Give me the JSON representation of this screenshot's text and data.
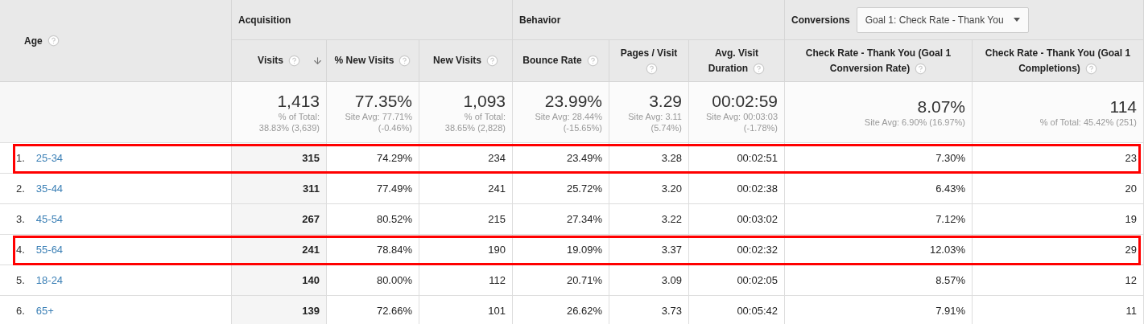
{
  "dimension": {
    "label": "Age"
  },
  "groups": [
    {
      "label": "Acquisition",
      "columns": [
        {
          "label": "Visits",
          "sorted": true
        },
        {
          "label": "% New Visits",
          "sorted": false
        },
        {
          "label": "New Visits",
          "sorted": false
        }
      ]
    },
    {
      "label": "Behavior",
      "columns": [
        {
          "label": "Bounce Rate",
          "sorted": false
        },
        {
          "label": "Pages / Visit",
          "sorted": false
        },
        {
          "label": "Avg. Visit Duration",
          "sorted": false
        }
      ]
    },
    {
      "label": "Conversions",
      "goal_select": "Goal 1: Check Rate - Thank You",
      "columns": [
        {
          "label": "Check Rate - Thank You (Goal 1 Conversion Rate)",
          "sorted": false
        },
        {
          "label": "Check Rate - Thank You (Goal 1 Completions)",
          "sorted": false
        }
      ]
    }
  ],
  "totals": [
    {
      "value": "1,413",
      "detail": [
        "% of Total:",
        "38.83% (3,639)"
      ]
    },
    {
      "value": "77.35%",
      "detail": [
        "Site Avg: 77.71%",
        "(-0.46%)"
      ]
    },
    {
      "value": "1,093",
      "detail": [
        "% of Total:",
        "38.65% (2,828)"
      ]
    },
    {
      "value": "23.99%",
      "detail": [
        "Site Avg: 28.44%",
        "(-15.65%)"
      ]
    },
    {
      "value": "3.29",
      "detail": [
        "Site Avg: 3.11",
        "(5.74%)"
      ]
    },
    {
      "value": "00:02:59",
      "detail": [
        "Site Avg: 00:03:03",
        "(-1.78%)"
      ]
    },
    {
      "value": "8.07%",
      "detail": [
        "Site Avg: 6.90% (16.97%)"
      ]
    },
    {
      "value": "114",
      "detail": [
        "% of Total: 45.42% (251)"
      ]
    }
  ],
  "rows": [
    {
      "rank": "1.",
      "age": "25-34",
      "highlighted": true,
      "cells": [
        "315",
        "74.29%",
        "234",
        "23.49%",
        "3.28",
        "00:02:51",
        "7.30%",
        "23"
      ]
    },
    {
      "rank": "2.",
      "age": "35-44",
      "highlighted": false,
      "cells": [
        "311",
        "77.49%",
        "241",
        "25.72%",
        "3.20",
        "00:02:38",
        "6.43%",
        "20"
      ]
    },
    {
      "rank": "3.",
      "age": "45-54",
      "highlighted": false,
      "cells": [
        "267",
        "80.52%",
        "215",
        "27.34%",
        "3.22",
        "00:03:02",
        "7.12%",
        "19"
      ]
    },
    {
      "rank": "4.",
      "age": "55-64",
      "highlighted": true,
      "cells": [
        "241",
        "78.84%",
        "190",
        "19.09%",
        "3.37",
        "00:02:32",
        "12.03%",
        "29"
      ]
    },
    {
      "rank": "5.",
      "age": "18-24",
      "highlighted": false,
      "cells": [
        "140",
        "80.00%",
        "112",
        "20.71%",
        "3.09",
        "00:02:05",
        "8.57%",
        "12"
      ]
    },
    {
      "rank": "6.",
      "age": "65+",
      "highlighted": false,
      "cells": [
        "139",
        "72.66%",
        "101",
        "26.62%",
        "3.73",
        "00:05:42",
        "7.91%",
        "11"
      ]
    }
  ]
}
